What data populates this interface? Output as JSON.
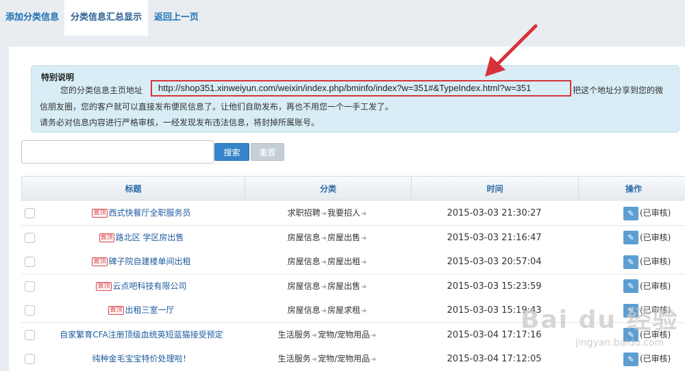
{
  "tabs": [
    {
      "label": "添加分类信息"
    },
    {
      "label": "分类信息汇总显示"
    },
    {
      "label": "返回上一页"
    }
  ],
  "notice": {
    "title": "特别说明",
    "line1_prefix": "您的分类信息主页地址",
    "url": "http://shop351.xinweiyun.com/weixin/index.php/bminfo/index?w=351#&TypeIndex.html?w=351",
    "line1_suffix": "把这个地址分享到您的微",
    "line2": "信朋友圈，您的客户就可以直接发布便民信息了。让他们自助发布，再也不用您一个一手工发了。",
    "line3": "请务必对信息内容进行严格审核，一经发现发布违法信息，将封掉所属账号。"
  },
  "search": {
    "value": "",
    "search_label": "搜索",
    "reset_label": "重置"
  },
  "table": {
    "headers": [
      "标题",
      "分类",
      "时间",
      "操作"
    ],
    "badge_text": "置顶",
    "rows": [
      {
        "badge": true,
        "title": "西式快餐厅全职服务员",
        "cat1": "求职招聘",
        "cat2": "我要招人",
        "time": "2015-03-03 21:30:27",
        "status": "(已审核)"
      },
      {
        "badge": true,
        "title": "路北区 学区房出售",
        "cat1": "房屋信息",
        "cat2": "房屋出售",
        "time": "2015-03-03 21:16:47",
        "status": "(已审核)"
      },
      {
        "badge": true,
        "title": "碑子院自建楼单间出租",
        "cat1": "房屋信息",
        "cat2": "房屋出租",
        "time": "2015-03-03 20:57:04",
        "status": "(已审核)"
      },
      {
        "badge": true,
        "title": "云点吧科技有限公司",
        "cat1": "房屋信息",
        "cat2": "房屋出售",
        "time": "2015-03-03 15:23:59",
        "status": "(已审核)"
      },
      {
        "badge": true,
        "title": "出租三室一厅",
        "cat1": "房屋信息",
        "cat2": "房屋求租",
        "time": "2015-03-03 15:19:43",
        "status": "(已审核)"
      },
      {
        "badge": false,
        "title": "自家繁育CFA注册顶级血统英短蓝猫接受预定",
        "cat1": "生活服务",
        "cat2": "宠物/宠物用品",
        "time": "2015-03-04 17:17:16",
        "status": "(已审核)"
      },
      {
        "badge": false,
        "title": "纯种金毛宝宝特价处理啦！",
        "cat1": "生活服务",
        "cat2": "宠物/宠物用品",
        "time": "2015-03-04 17:12:05",
        "status": "(已审核)"
      }
    ]
  },
  "watermark": {
    "main": "Bai du 经验",
    "sub": "jingyan.baidu.com"
  },
  "colors": {
    "accent": "#3585c8",
    "annotation": "#d7323a",
    "notice_bg": "#d8edf5",
    "link": "#1e5a9e"
  },
  "icons": {
    "edit": "edit-icon",
    "arrow": "right-arrow-icon",
    "badge": "top-badge"
  }
}
